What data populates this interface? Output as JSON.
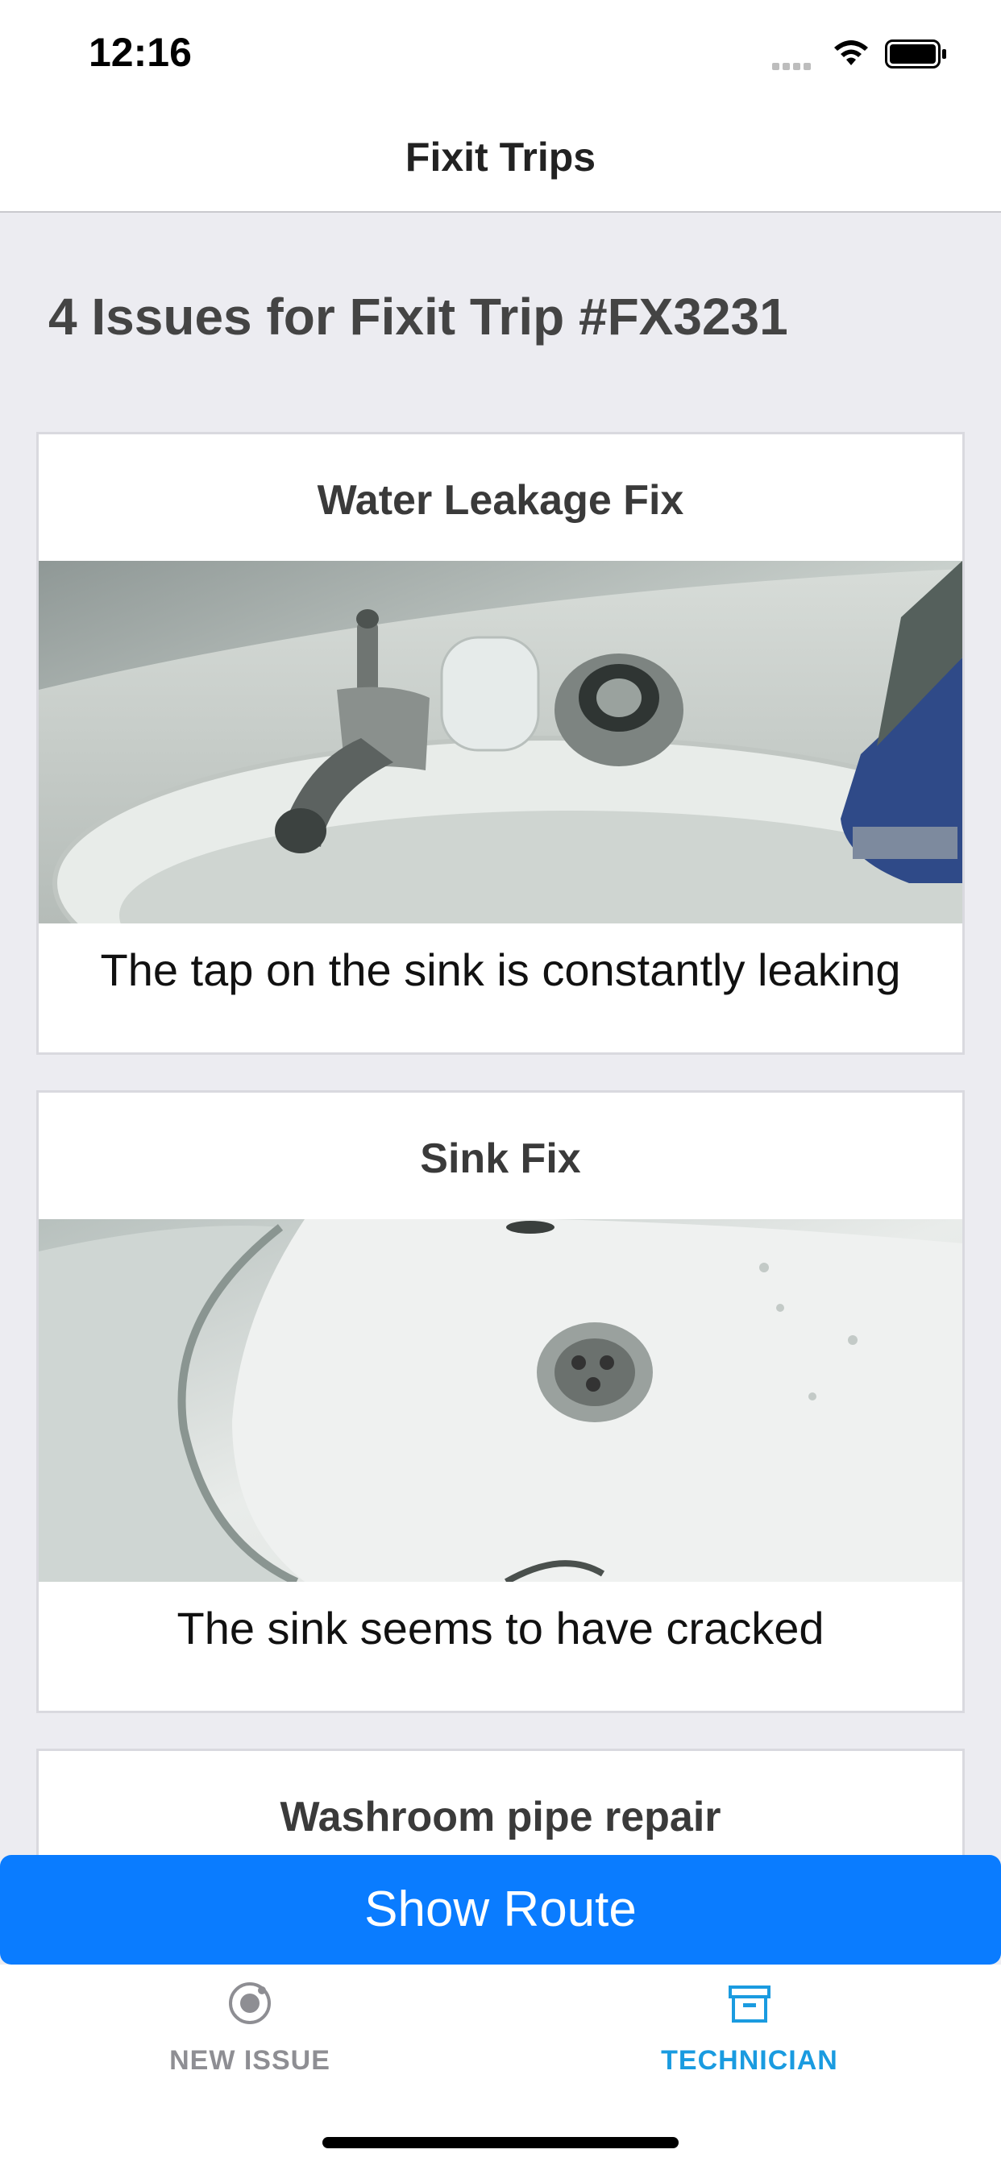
{
  "status_bar": {
    "time": "12:16"
  },
  "nav": {
    "title": "Fixit Trips"
  },
  "heading": "4 Issues for Fixit Trip #FX3231",
  "issues": [
    {
      "title": "Water Leakage Fix",
      "description": "The tap on the sink is constantly leaking",
      "image": "leaking-tap-photo"
    },
    {
      "title": "Sink Fix",
      "description": "The sink seems to have cracked",
      "image": "cracked-sink-photo"
    },
    {
      "title": "Washroom pipe repair"
    }
  ],
  "actions": {
    "show_route": "Show Route"
  },
  "tabs": [
    {
      "label": "NEW ISSUE",
      "icon": "target-icon",
      "active": false
    },
    {
      "label": "TECHNICIAN",
      "icon": "archive-box-icon",
      "active": true
    }
  ],
  "colors": {
    "accent": "#0a7cff",
    "tab_active": "#1a9be0",
    "tab_inactive": "#8e8e93",
    "background": "#ececf1"
  }
}
